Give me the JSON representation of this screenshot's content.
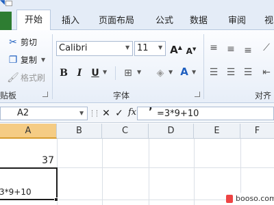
{
  "tabs": [
    "开始",
    "插入",
    "页面布局",
    "公式",
    "数据",
    "审阅",
    "视"
  ],
  "clipboard": {
    "cut": "剪切",
    "copy": "复制",
    "format_painter": "格式刷",
    "group_label": "贴板"
  },
  "font": {
    "name": "Calibri",
    "size": "11",
    "group_label": "字体"
  },
  "alignment": {
    "group_label": "对齐"
  },
  "formula_bar": {
    "name_box": "A2",
    "fx": "fx",
    "content": "=3*9+10"
  },
  "columns": [
    "A",
    "B",
    "C",
    "D",
    "E",
    "F"
  ],
  "cells": {
    "a1_value": "37",
    "a2_text": "3*9+10"
  },
  "watermark": "booso.com",
  "colors": {
    "file_tab": "#2e7d32",
    "accent": "#1f5fbf",
    "select_border": "#1b1b1b"
  }
}
